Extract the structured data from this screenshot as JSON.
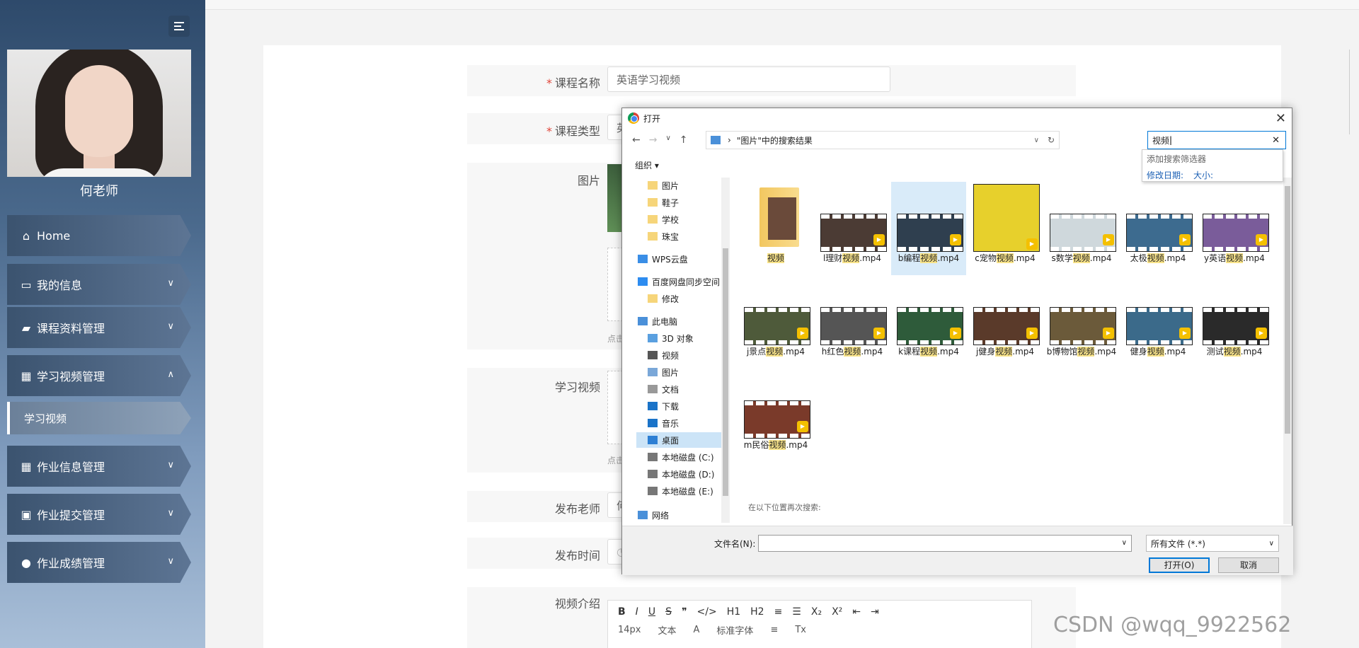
{
  "sidebar": {
    "teacher_name": "何老师",
    "menu": [
      {
        "label": "Home",
        "icon": "home-icon"
      },
      {
        "label": "我的信息",
        "icon": "id-card-icon"
      },
      {
        "label": "课程资料管理",
        "icon": "ticket-icon"
      },
      {
        "label": "学习视频管理",
        "icon": "grid-icon"
      },
      {
        "label": "学习视频",
        "icon": ""
      },
      {
        "label": "作业信息管理",
        "icon": "grid-icon"
      },
      {
        "label": "作业提交管理",
        "icon": "clipboard-icon"
      },
      {
        "label": "作业成绩管理",
        "icon": "bulb-icon"
      }
    ]
  },
  "form": {
    "course_name_label": "课程名称",
    "course_name_value": "英语学习视频",
    "course_type_label": "课程类型",
    "course_type_value": "英",
    "image_label": "图片",
    "video_label": "学习视频",
    "teacher_label": "发布老师",
    "teacher_value": "何",
    "time_label": "发布时间",
    "intro_label": "视频介绍",
    "hint1": "点击",
    "hint2": "点击"
  },
  "editor": {
    "toolbar1": [
      "B",
      "I",
      "U",
      "S",
      "❞",
      "</>",
      "H1",
      "H2",
      "≡",
      "☰",
      "X₂",
      "X²",
      "⇤",
      "⇥"
    ],
    "font_size": "14px",
    "text_style": "文本",
    "font_family": "标准字体"
  },
  "dialog": {
    "title": "打开",
    "path": "\"图片\"中的搜索结果",
    "search_value": "视频",
    "suggest_title": "添加搜索筛选器",
    "suggest_links": [
      "修改日期:",
      "大小:"
    ],
    "organize": "组织 ▾",
    "nav_items": [
      {
        "label": "图片",
        "kind": "folder"
      },
      {
        "label": "鞋子",
        "kind": "folder"
      },
      {
        "label": "学校",
        "kind": "folder"
      },
      {
        "label": "珠宝",
        "kind": "folder"
      },
      {
        "label": "WPS云盘",
        "kind": "cloud"
      },
      {
        "label": "百度网盘同步空间",
        "kind": "baidu"
      },
      {
        "label": "修改",
        "kind": "folder"
      },
      {
        "label": "此电脑",
        "kind": "pc"
      },
      {
        "label": "3D 对象",
        "kind": "obj"
      },
      {
        "label": "视频",
        "kind": "video"
      },
      {
        "label": "图片",
        "kind": "pic"
      },
      {
        "label": "文档",
        "kind": "doc"
      },
      {
        "label": "下载",
        "kind": "down"
      },
      {
        "label": "音乐",
        "kind": "music"
      },
      {
        "label": "桌面",
        "kind": "desk"
      },
      {
        "label": "本地磁盘 (C:)",
        "kind": "disk"
      },
      {
        "label": "本地磁盘 (D:)",
        "kind": "disk"
      },
      {
        "label": "本地磁盘 (E:)",
        "kind": "disk"
      },
      {
        "label": "网络",
        "kind": "net"
      }
    ],
    "files": [
      {
        "pre": "",
        "hl": "视频",
        "post": "",
        "kind": "folder"
      },
      {
        "pre": "l理财",
        "hl": "视频",
        "post": ".mp4",
        "kind": "video"
      },
      {
        "pre": "b编程",
        "hl": "视频",
        "post": ".mp4",
        "kind": "video"
      },
      {
        "pre": "c宠物",
        "hl": "视频",
        "post": ".mp4",
        "kind": "video"
      },
      {
        "pre": "s数学",
        "hl": "视频",
        "post": ".mp4",
        "kind": "video"
      },
      {
        "pre": "太极",
        "hl": "视频",
        "post": ".mp4",
        "kind": "video"
      },
      {
        "pre": "y英语",
        "hl": "视频",
        "post": ".mp4",
        "kind": "video"
      },
      {
        "pre": "j景点",
        "hl": "视频",
        "post": ".mp4",
        "kind": "video"
      },
      {
        "pre": "h红色",
        "hl": "视频",
        "post": ".mp4",
        "kind": "video"
      },
      {
        "pre": "k课程",
        "hl": "视频",
        "post": ".mp4",
        "kind": "video"
      },
      {
        "pre": "j健身",
        "hl": "视频",
        "post": ".mp4",
        "kind": "video"
      },
      {
        "pre": "b博物馆",
        "hl": "视频",
        "post": ".mp4",
        "kind": "video"
      },
      {
        "pre": "健身",
        "hl": "视频",
        "post": ".mp4",
        "kind": "video"
      },
      {
        "pre": "测试",
        "hl": "视频",
        "post": ".mp4",
        "kind": "video"
      },
      {
        "pre": "m民俗",
        "hl": "视频",
        "post": ".mp4",
        "kind": "video"
      }
    ],
    "search_again": "在以下位置再次搜索:",
    "filename_label": "文件名(N):",
    "filename_value": "",
    "filetype": "所有文件 (*.*)",
    "open_button": "打开(O)",
    "cancel_button": "取消"
  },
  "watermark": "CSDN @wqq_9922562"
}
